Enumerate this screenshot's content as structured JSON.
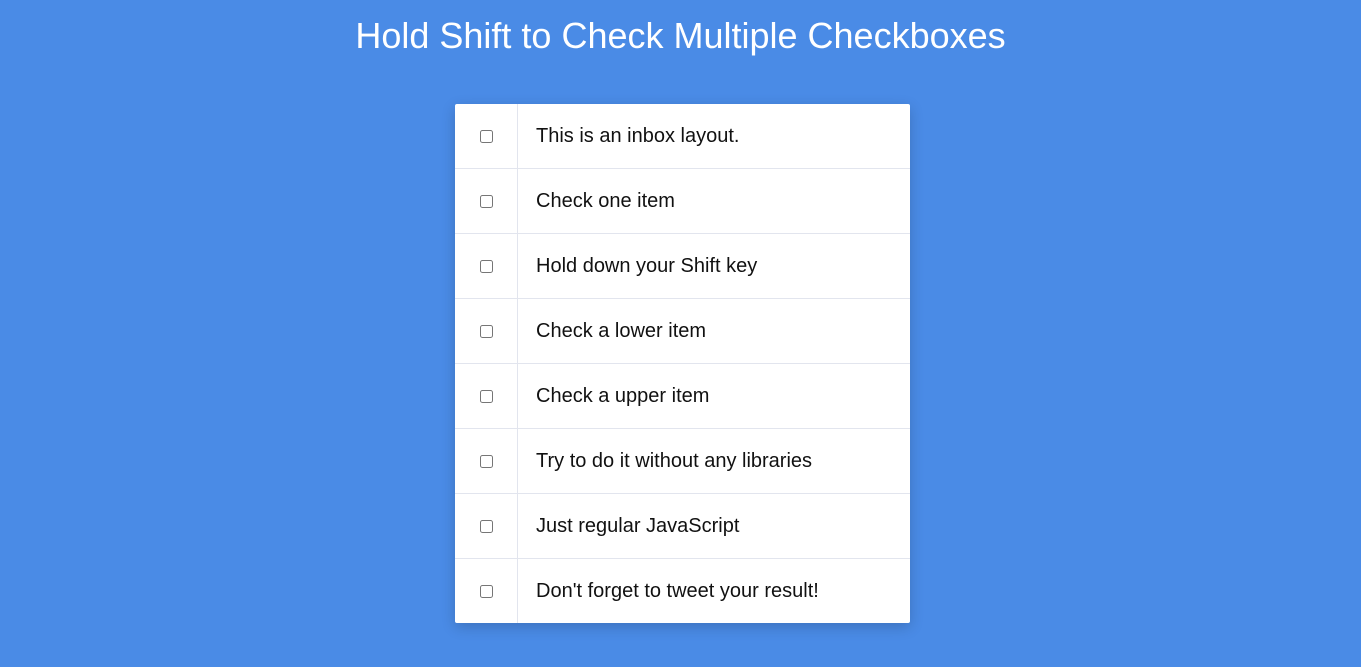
{
  "page": {
    "title": "Hold Shift to Check Multiple Checkboxes",
    "background_color": "#4a8be6"
  },
  "inbox": {
    "items": [
      {
        "label": "This is an inbox layout.",
        "checked": false
      },
      {
        "label": "Check one item",
        "checked": false
      },
      {
        "label": "Hold down your Shift key",
        "checked": false
      },
      {
        "label": "Check a lower item",
        "checked": false
      },
      {
        "label": "Check a upper item",
        "checked": false
      },
      {
        "label": "Try to do it without any libraries",
        "checked": false
      },
      {
        "label": "Just regular JavaScript",
        "checked": false
      },
      {
        "label": "Don't forget to tweet your result!",
        "checked": false
      }
    ]
  }
}
